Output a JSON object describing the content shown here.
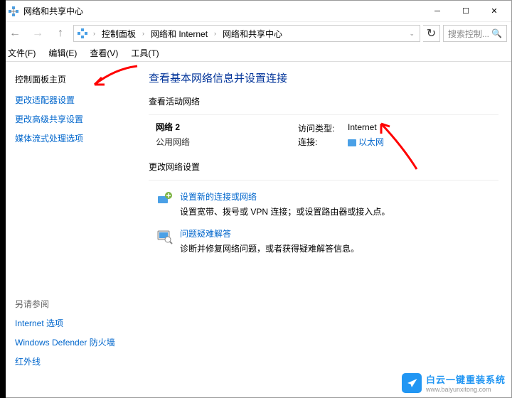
{
  "window": {
    "title": "网络和共享中心"
  },
  "nav": {
    "breadcrumbs": [
      "控制面板",
      "网络和 Internet",
      "网络和共享中心"
    ],
    "search_placeholder": "搜索控制..."
  },
  "menu": {
    "file": "文件(F)",
    "edit": "编辑(E)",
    "view": "查看(V)",
    "tools": "工具(T)"
  },
  "sidebar": {
    "home": "控制面板主页",
    "links": [
      "更改适配器设置",
      "更改高级共享设置",
      "媒体流式处理选项"
    ],
    "seealso_label": "另请参阅",
    "seealso": [
      "Internet 选项",
      "Windows Defender 防火墙",
      "红外线"
    ]
  },
  "main": {
    "heading": "查看基本网络信息并设置连接",
    "active_net_label": "查看活动网络",
    "network": {
      "name": "网络 2",
      "type": "公用网络",
      "access_label": "访问类型:",
      "access_value": "Internet",
      "conn_label": "连接:",
      "conn_value": "以太网"
    },
    "change_label": "更改网络设置",
    "actions": [
      {
        "title": "设置新的连接或网络",
        "desc": "设置宽带、拨号或 VPN 连接；或设置路由器或接入点。"
      },
      {
        "title": "问题疑难解答",
        "desc": "诊断并修复网络问题，或者获得疑难解答信息。"
      }
    ]
  },
  "watermark": {
    "cn": "白云一键重装系统",
    "url": "www.baiyunxitong.com"
  }
}
